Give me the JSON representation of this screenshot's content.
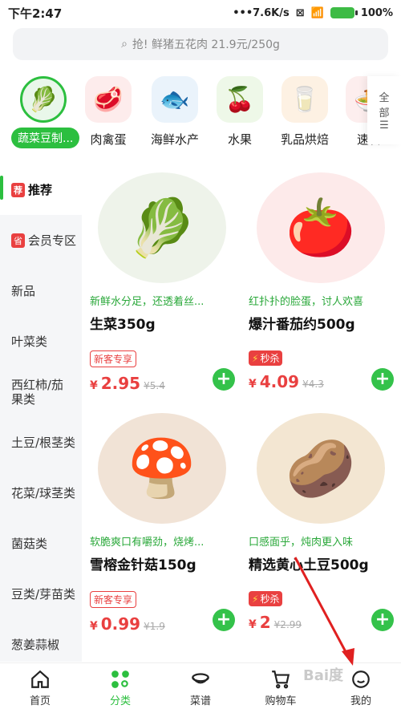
{
  "status": {
    "time": "下午2:47",
    "network": "•••7.6K/s",
    "battery": "100%"
  },
  "search": {
    "placeholder": "抢! 鲜猪五花肉 21.9元/250g"
  },
  "categories": [
    {
      "label": "蔬菜豆制...",
      "icon": "🥬",
      "selected": true
    },
    {
      "label": "肉禽蛋",
      "icon": "🥩"
    },
    {
      "label": "海鲜水产",
      "icon": "🐟"
    },
    {
      "label": "水果",
      "icon": "🍒"
    },
    {
      "label": "乳品烘焙",
      "icon": "🥛"
    },
    {
      "label": "速食",
      "icon": "🍜"
    }
  ],
  "all_categories": {
    "label1": "全",
    "label2": "部"
  },
  "sidebar": [
    {
      "label": "推荐",
      "tag": "荐",
      "selected": true
    },
    {
      "label": "会员专区",
      "tag": "省"
    },
    {
      "label": "新品"
    },
    {
      "label": "叶菜类"
    },
    {
      "label": "西红柿/茄果类"
    },
    {
      "label": "土豆/根茎类"
    },
    {
      "label": "花菜/球茎类"
    },
    {
      "label": "菌菇类"
    },
    {
      "label": "豆类/芽苗类"
    },
    {
      "label": "葱姜蒜椒"
    }
  ],
  "products": [
    {
      "desc": "新鲜水分足，还透着丝...",
      "title": "生菜350g",
      "badge": "新客专享",
      "badge_type": "new",
      "currency": "¥",
      "price": "2.95",
      "old_price": "¥5.4",
      "icon": "🥬"
    },
    {
      "desc": "红扑扑的脸蛋，讨人欢喜",
      "title": "爆汁番茄约500g",
      "badge": "秒杀",
      "badge_type": "sec",
      "currency": "¥",
      "price": "4.09",
      "old_price": "¥4.3",
      "icon": "🍅"
    },
    {
      "desc": "软脆爽口有嚼劲，烧烤...",
      "title": "雪榕金针菇150g",
      "badge": "新客专享",
      "badge_type": "new",
      "currency": "¥",
      "price": "0.99",
      "old_price": "¥1.9",
      "icon": "🍄"
    },
    {
      "desc": "口感面乎，炖肉更入味",
      "title": "精选黄心土豆500g",
      "badge": "秒杀",
      "badge_type": "sec",
      "currency": "¥",
      "price": "2",
      "old_price": "¥2.99",
      "icon": "🥔"
    }
  ],
  "tabs": [
    {
      "label": "首页"
    },
    {
      "label": "分类",
      "selected": true
    },
    {
      "label": "菜谱"
    },
    {
      "label": "购物车"
    },
    {
      "label": "我的"
    }
  ],
  "watermark": "Bai度"
}
